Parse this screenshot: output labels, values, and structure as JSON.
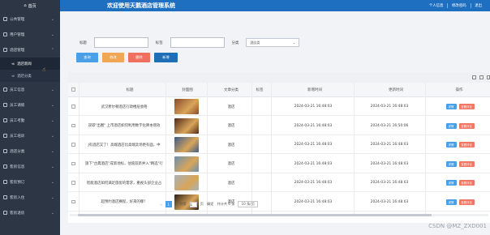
{
  "sidebar": {
    "home": "首页",
    "items": [
      {
        "label": "公共管理",
        "icon": "grid-icon",
        "chev": "⌄"
      },
      {
        "label": "用户管理",
        "icon": "user-icon",
        "chev": "⌄"
      },
      {
        "label": "酒店管理",
        "icon": "hotel-icon",
        "chev": "⌃"
      },
      {
        "label": "员工信息",
        "icon": "doc-icon",
        "chev": "⌄"
      },
      {
        "label": "员工请假",
        "icon": "doc-icon",
        "chev": "⌄"
      },
      {
        "label": "员工考勤",
        "icon": "doc-icon",
        "chev": "⌄"
      },
      {
        "label": "员工培训",
        "icon": "doc-icon",
        "chev": "⌄"
      },
      {
        "label": "酒店分类",
        "icon": "doc-icon",
        "chev": "⌄"
      },
      {
        "label": "客房信息",
        "icon": "doc-icon",
        "chev": "⌄"
      },
      {
        "label": "客房预订",
        "icon": "doc-icon",
        "chev": "⌄"
      },
      {
        "label": "客房入住",
        "icon": "doc-icon",
        "chev": "⌄"
      },
      {
        "label": "客房退房",
        "icon": "doc-icon",
        "chev": "⌄"
      }
    ],
    "subs": [
      {
        "label": "酒店新闻",
        "active": true
      },
      {
        "label": "酒店分类",
        "active": false
      }
    ]
  },
  "header": {
    "title": "欢迎使用天鹅酒店管理系统",
    "profile": "个人信息",
    "password": "修改密码",
    "logout": "退出"
  },
  "search": {
    "title_label": "标题",
    "tag_label": "标签",
    "category_label": "分类",
    "category_value": "酒店类",
    "title_value": "",
    "tag_value": ""
  },
  "buttons": {
    "search": "查询",
    "edit": "修改",
    "delete": "删除",
    "add": "新增"
  },
  "table": {
    "headers": [
      "标题",
      "封面图",
      "文章分类",
      "标签",
      "新增时间",
      "更新时间",
      "操作"
    ],
    "rows": [
      {
        "title": "武汉希尔顿酒店行政楼层会晤",
        "category": "酒店",
        "tag": "",
        "created": "2024-03-21 16:48:03",
        "updated": "2024-03-21 16:48:03",
        "thumb": "#8a4a2a"
      },
      {
        "title": "双碳\"出圈\" 上市酒店如何利用数字化降本增效",
        "category": "酒店",
        "tag": "",
        "created": "2024-03-21 16:48:03",
        "updated": "2024-03-21 16:50:06",
        "thumb": "#4f2a1a"
      },
      {
        "title": "J有酒店又了！高端酒店比高端卖场更有面，中",
        "category": "酒店",
        "tag": "",
        "created": "2024-03-21 16:48:03",
        "updated": "2024-03-21 16:48:03",
        "thumb": "#3b5a8a"
      },
      {
        "title": "旗下\"古典酒店\"成新地标，估值双新并入\"精选\"行",
        "category": "酒店",
        "tag": "",
        "created": "2024-03-21 16:48:03",
        "updated": "2024-03-21 16:48:03",
        "thumb": "#6a8fb0"
      },
      {
        "title": "智能酒店如何满足旅客的需求，重视头部企业占",
        "category": "酒店",
        "tag": "",
        "created": "2024-03-21 16:48:03",
        "updated": "2024-03-21 16:48:03",
        "thumb": "#a7b3b8"
      },
      {
        "title": "超预约酒店赛程，好来的哪！",
        "category": "酒店",
        "tag": "",
        "created": "2024-03-21 16:48:03",
        "updated": "2024-03-21 16:48:03",
        "thumb": "#2a1e14"
      }
    ],
    "op_detail": "详情",
    "op_review": "查看评论"
  },
  "pager": {
    "current": "1",
    "goto": "到第",
    "page_unit": "页",
    "confirm": "确定",
    "total": "共计共 6 条",
    "size": "10 条/页"
  },
  "watermark": "CSDN @MZ_ZXD001"
}
